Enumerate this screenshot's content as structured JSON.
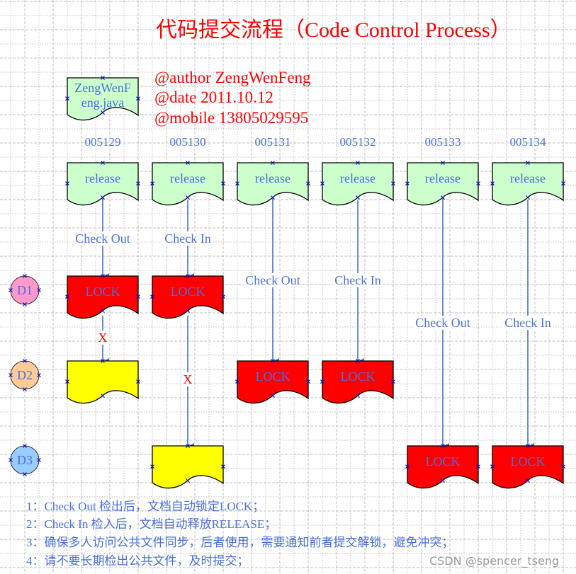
{
  "title": "代码提交流程（Code Control Process）",
  "meta": {
    "author": "@author ZengWenFeng",
    "date": "@date 2011.10.12",
    "mobile": "@mobile 13805029595"
  },
  "source_file": {
    "line1": "ZengWenF",
    "line2": "eng.java"
  },
  "versions": [
    "005129",
    "005130",
    "005131",
    "005132",
    "005133",
    "005134"
  ],
  "release_label": "release",
  "lock_label": "LOCK",
  "developers": [
    {
      "label": "D1",
      "color": "#ff99cc"
    },
    {
      "label": "D2",
      "color": "#ffcc99"
    },
    {
      "label": "D3",
      "color": "#99ccff"
    }
  ],
  "actions": {
    "check_out": "Check  Out",
    "check_in": "Check  In",
    "blocked": "X"
  },
  "colors": {
    "release_fill": "#ccffcc",
    "lock_fill": "#ff0000",
    "waiting_fill": "#ffff00",
    "text_blue": "#4a6fe0",
    "accent_red": "#ff0000",
    "arrow": "#4472c4"
  },
  "notes": [
    "1：Check Out 检出后，文档自动锁定LOCK；",
    "2：Check In 检入后，文档自动释放RELEASE；",
    "3：确保多人访问公共文件同步，后者使用，需要通知前者提交解锁，避免冲突；",
    "4：请不要长期检出公共文件，及时提交；"
  ],
  "watermark": "CSDN @spencer_tseng"
}
